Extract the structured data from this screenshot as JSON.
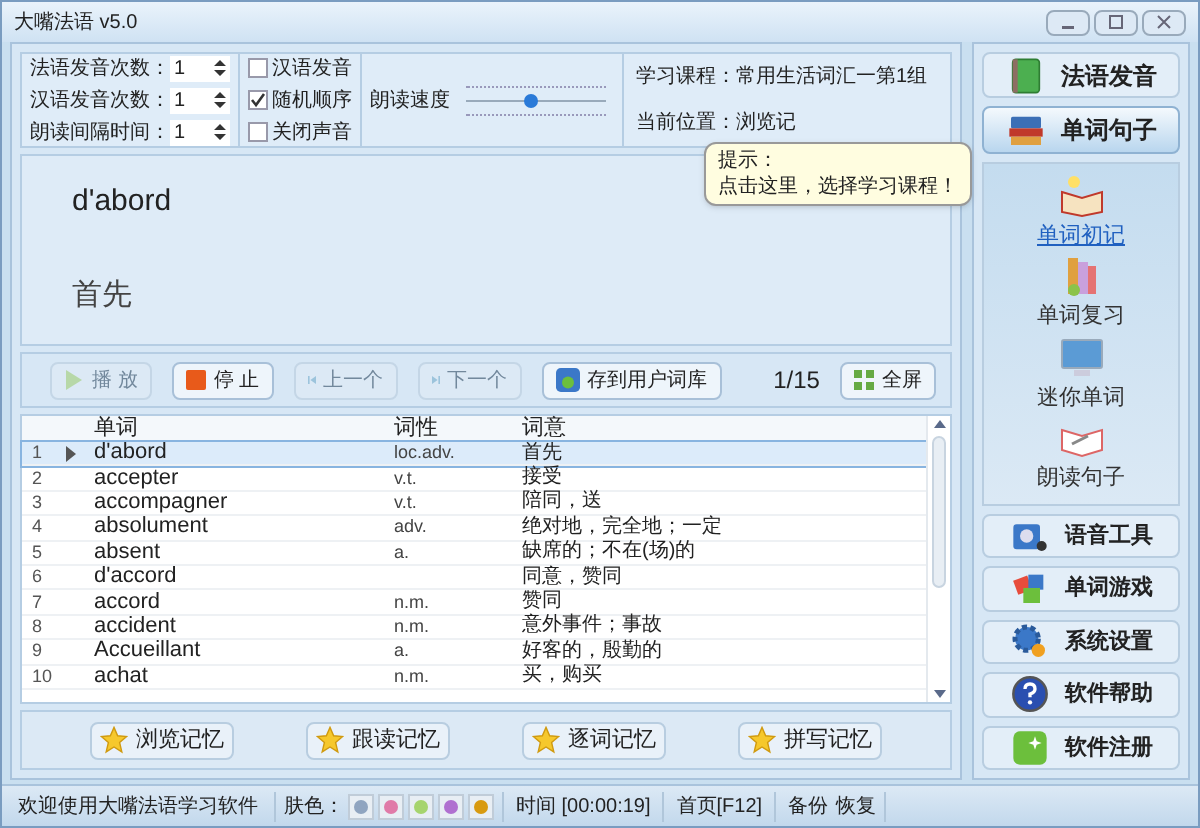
{
  "window": {
    "title": "大嘴法语 v5.0"
  },
  "settings": {
    "spinners": [
      {
        "label": "法语发音次数：",
        "value": "1"
      },
      {
        "label": "汉语发音次数：",
        "value": "1"
      },
      {
        "label": "朗读间隔时间：",
        "value": "1"
      }
    ],
    "checkboxes": [
      {
        "label": "汉语发音",
        "checked": false
      },
      {
        "label": "随机顺序",
        "checked": true
      },
      {
        "label": "关闭声音",
        "checked": false
      }
    ],
    "speed": {
      "label": "朗读速度",
      "level": 0.45
    }
  },
  "course": {
    "course_line": "学习课程：常用生活词汇一第1组",
    "position_line": "当前位置：浏览记"
  },
  "tooltip": {
    "title": "提示：",
    "text": "点击这里，选择学习课程！"
  },
  "display": {
    "word": "d'abord",
    "meaning": "首先"
  },
  "toolbar": {
    "buttons": [
      {
        "kind": "play",
        "label": "播 放",
        "disabled": true
      },
      {
        "kind": "stop",
        "label": "停 止",
        "disabled": false
      },
      {
        "kind": "prev",
        "label": "上一个",
        "disabled": true
      },
      {
        "kind": "next",
        "label": "下一个",
        "disabled": true
      },
      {
        "kind": "save",
        "label": "存到用户词库",
        "disabled": false
      }
    ],
    "counter": "1/15",
    "fullscreen": "全屏"
  },
  "table": {
    "columns": [
      "单词",
      "词性",
      "词意"
    ],
    "rows": [
      {
        "num": "1",
        "word": "d'abord",
        "pos": "loc.adv.",
        "meaning": "首先",
        "selected": true
      },
      {
        "num": "2",
        "word": "accepter",
        "pos": "v.t.",
        "meaning": "接受",
        "selected": false
      },
      {
        "num": "3",
        "word": "accompagner",
        "pos": "v.t.",
        "meaning": "陪同，送",
        "selected": false
      },
      {
        "num": "4",
        "word": "absolument",
        "pos": "adv.",
        "meaning": "绝对地，完全地；一定",
        "selected": false
      },
      {
        "num": "5",
        "word": "absent",
        "pos": "a.",
        "meaning": "缺席的；不在(场)的",
        "selected": false
      },
      {
        "num": "6",
        "word": "d'accord",
        "meaning": "同意，赞同",
        "selected": false
      },
      {
        "num": "7",
        "word": "accord",
        "pos": "n.m.",
        "meaning": "赞同",
        "selected": false
      },
      {
        "num": "8",
        "word": "accident",
        "pos": "n.m.",
        "meaning": "意外事件；事故",
        "selected": false
      },
      {
        "num": "9",
        "word": "Accueillant",
        "pos": "a.",
        "meaning": "好客的，殷勤的",
        "selected": false
      },
      {
        "num": "10",
        "word": "achat",
        "pos": "n.m.",
        "meaning": "买，购买",
        "selected": false
      }
    ]
  },
  "memory_buttons": [
    "浏览记忆",
    "跟读记忆",
    "逐词记忆",
    "拼写记忆"
  ],
  "sidebar": {
    "top": [
      {
        "label": "法语发音",
        "kind": "book",
        "selected": false
      },
      {
        "label": "单词句子",
        "kind": "books",
        "selected": true
      }
    ],
    "subitems": [
      {
        "label": "单词初记",
        "kind": "openbook",
        "selected": true
      },
      {
        "label": "单词复习",
        "kind": "stack",
        "selected": false
      },
      {
        "label": "迷你单词",
        "kind": "monitor",
        "selected": false
      },
      {
        "label": "朗读句子",
        "kind": "pen",
        "selected": false
      }
    ],
    "bottom": [
      {
        "label": "语音工具",
        "kind": "tools"
      },
      {
        "label": "单词游戏",
        "kind": "puzzle"
      },
      {
        "label": "系统设置",
        "kind": "gear"
      },
      {
        "label": "软件帮助",
        "kind": "help"
      },
      {
        "label": "软件注册",
        "kind": "register"
      }
    ]
  },
  "status_bar": {
    "welcome": "欢迎使用大嘴法语学习软件",
    "skin_label": "肤色：",
    "skins": [
      {
        "color": "#8fa4c0"
      },
      {
        "color": "#e07aa8"
      },
      {
        "color": "#a6d46e"
      },
      {
        "color": "#b070d0"
      },
      {
        "color": "#d89a10"
      }
    ],
    "time": "时间 [00:00:19]",
    "home": "首页[F12]",
    "backup": "备份",
    "restore": "恢复"
  }
}
